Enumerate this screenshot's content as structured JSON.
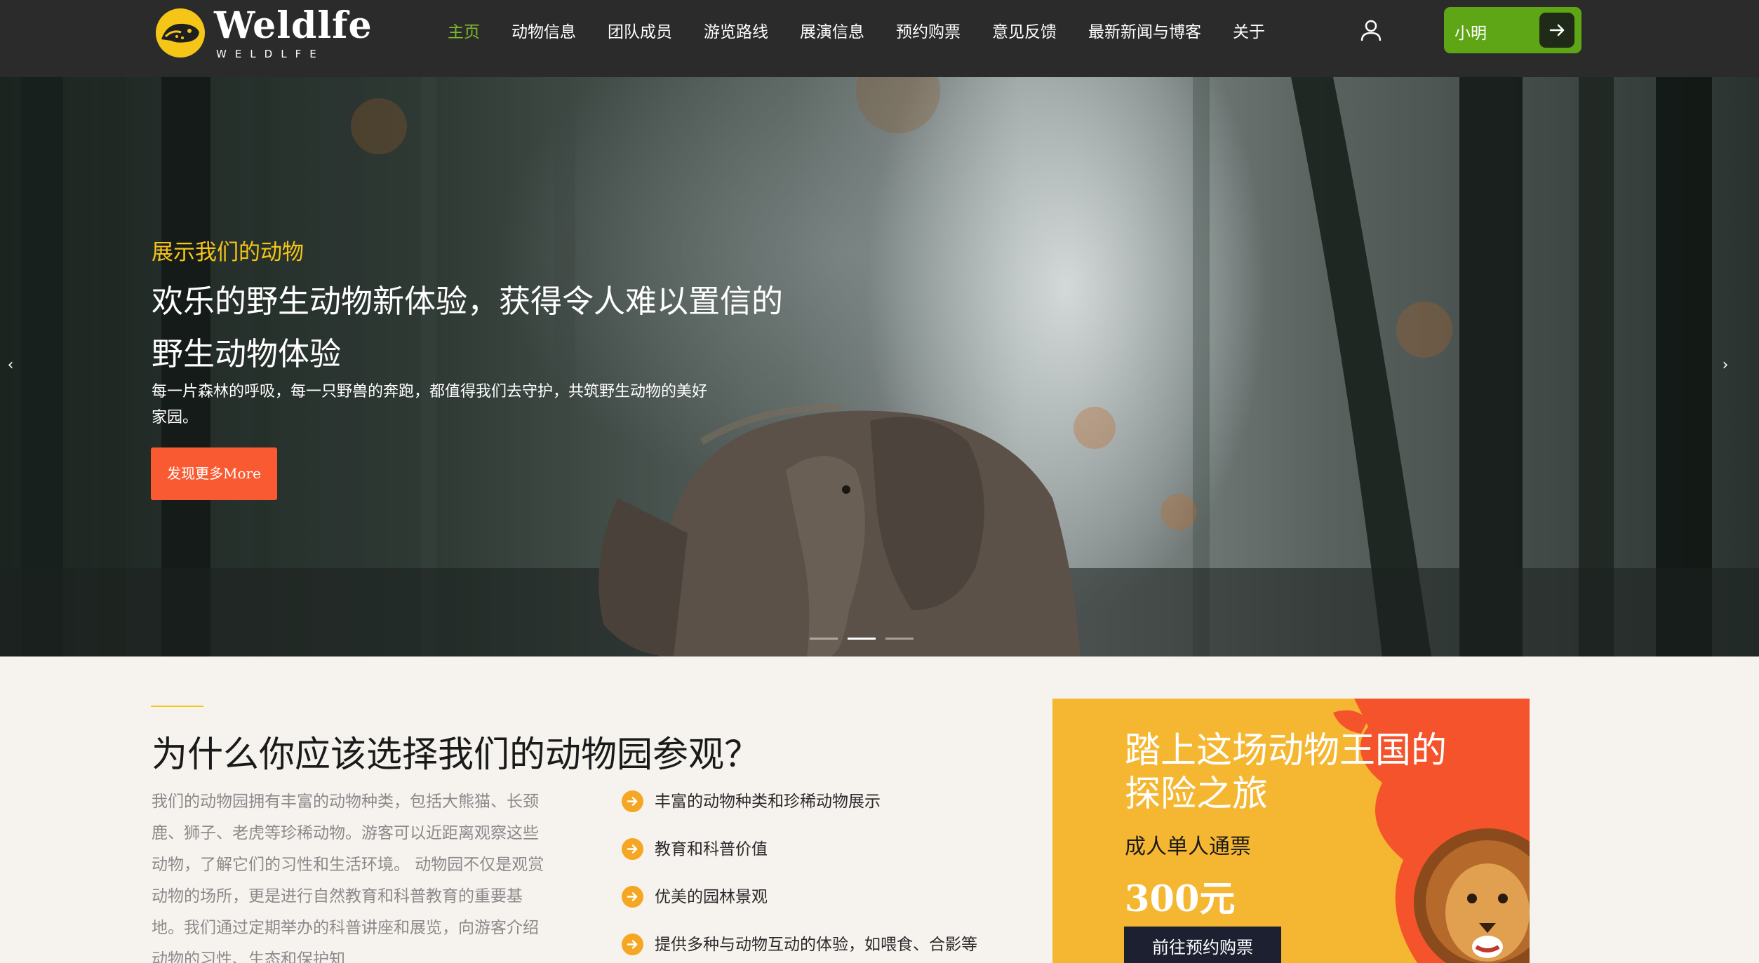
{
  "header": {
    "logo": {
      "name": "Weldlfe",
      "sub": "WELDLFE"
    },
    "nav": [
      {
        "label": "主页",
        "active": true
      },
      {
        "label": "动物信息"
      },
      {
        "label": "团队成员"
      },
      {
        "label": "游览路线"
      },
      {
        "label": "展演信息"
      },
      {
        "label": "预约购票"
      },
      {
        "label": "意见反馈"
      },
      {
        "label": "最新新闻与博客"
      },
      {
        "label": "关于"
      }
    ],
    "user_icon": "user-icon",
    "user_button": {
      "name": "小明",
      "icon": "arrow-right-icon"
    }
  },
  "hero": {
    "tagline": "展示我们的动物",
    "title": "欢乐的野生动物新体验，获得令人难以置信的野生动物体验",
    "description": "每一片森林的呼吸，每一只野兽的奔跑，都值得我们去守护，共筑野生动物的美好家园。",
    "button": "发现更多More",
    "prev_arrow": "‹",
    "next_arrow": "›",
    "slide_count": 3,
    "active_slide": 1
  },
  "why": {
    "title": "为什么你应该选择我们的动物园参观？",
    "text": "我们的动物园拥有丰富的动物种类，包括大熊猫、长颈鹿、狮子、老虎等珍稀动物。游客可以近距离观察这些动物，了解它们的习性和生活环境。 动物园不仅是观赏动物的场所，更是进行自然教育和科普教育的重要基地。我们通过定期举办的科普讲座和展览，向游客介绍动物的习性、生态和保护知",
    "features": [
      "丰富的动物种类和珍稀动物展示",
      "教育和科普价值",
      "优美的园林景观",
      "提供多种与动物互动的体验，如喂食、合影等"
    ]
  },
  "promo": {
    "title": "踏上这场动物王国的探险之旅",
    "subtitle": "成人单人通票",
    "price": "300元",
    "button": "前往预约购票"
  },
  "colors": {
    "header_bg": "#2b2b2b",
    "nav_active": "#7dbb2a",
    "user_button": "#5ea615",
    "accent_yellow": "#f5c518",
    "hero_button": "#fa5a32",
    "promo_bg": "#f5b731",
    "promo_splash": "#f5532b",
    "page_bg": "#f6f3ef"
  }
}
